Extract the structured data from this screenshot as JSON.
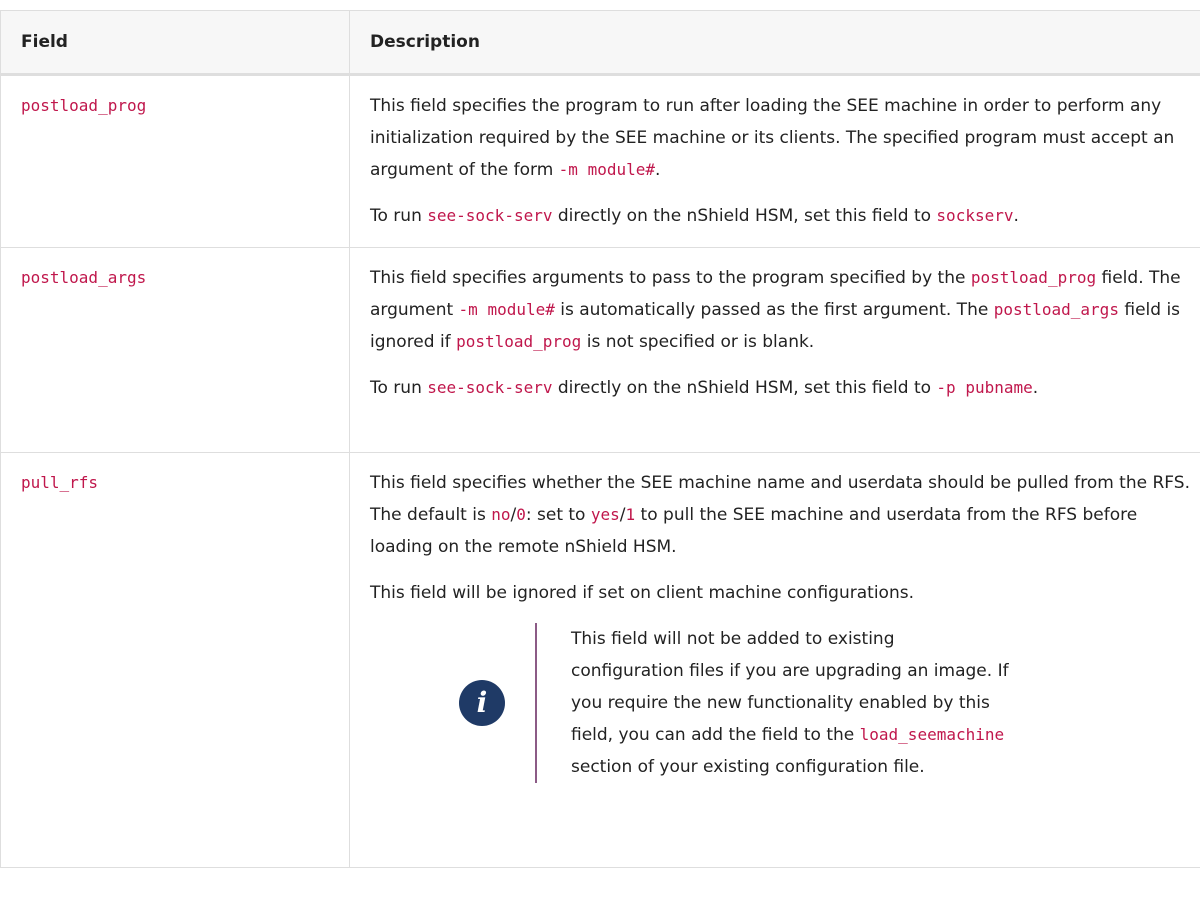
{
  "headers": {
    "field": "Field",
    "description": "Description"
  },
  "rows": [
    {
      "field": "postload_prog",
      "p1": {
        "t1": "This field specifies the program to run after loading the SEE machine in order to perform any initialization required by the SEE machine or its clients. The specified program must accept an argument of the form ",
        "c1": "-m module#",
        "t2": "."
      },
      "p2": {
        "t1": "To run ",
        "c1": "see-sock-serv",
        "t2": " directly on the nShield HSM, set this field to ",
        "c2": "sockserv",
        "t3": "."
      }
    },
    {
      "field": "postload_args",
      "p1": {
        "t1": "This field specifies arguments to pass to the program specified by the ",
        "c1": "post­load_prog",
        "t2": " field. The argument ",
        "c2": "-m module#",
        "t3": " is automatically passed as the first argument. The ",
        "c3": "postload_args",
        "t4": " field is ignored if ",
        "c4": "postload_prog",
        "t5": " is not specified or is blank."
      },
      "p2": {
        "t1": "To run ",
        "c1": "see-sock-serv",
        "t2": " directly on the nShield HSM, set this field to ",
        "c2": "-p pubname",
        "t3": "."
      }
    },
    {
      "field": "pull_rfs",
      "p1": {
        "t1": "This field specifies whether the SEE machine name and userdata should be pulled from the RFS. The default is ",
        "c1": "no",
        "t2": "/",
        "c2": "0",
        "t3": ": set to ",
        "c3": "yes",
        "t4": "/",
        "c4": "1",
        "t5": " to pull the SEE machine and userdata from the RFS before loading on the remote nShield HSM."
      },
      "p2": {
        "t1": "This field will be ignored if set on client machine configurations."
      },
      "note": {
        "t1": "This field will not be added to existing configuration files if you are upgrading an image. If you require the new functionality enabled by this field, you can add the field to the ",
        "c1": "load_seemachine",
        "t2": " section of your exist­ing configuration file."
      }
    }
  ],
  "icons": {
    "note": "info-icon",
    "note_glyph": "i"
  },
  "colors": {
    "code": "#c0174c",
    "icon_bg": "#1f3a66",
    "note_bar": "#8c5b86",
    "header_bg": "#f7f7f7",
    "border": "#dedede"
  }
}
